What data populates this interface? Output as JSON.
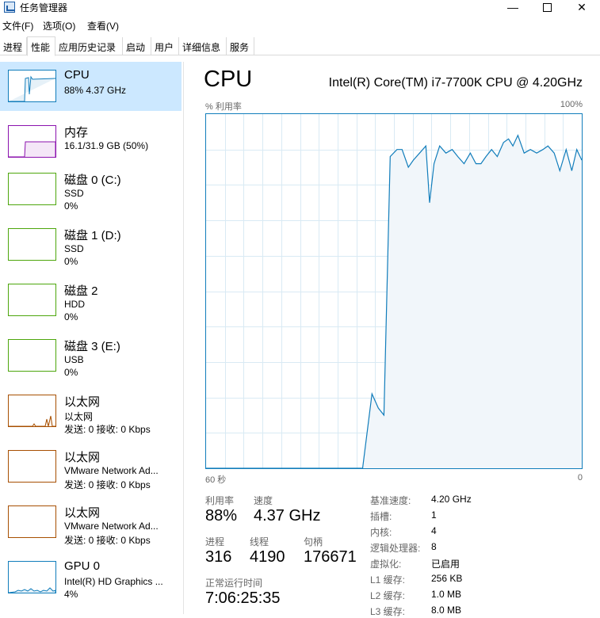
{
  "window": {
    "title": "任务管理器",
    "minimize": "—",
    "close": "✕"
  },
  "menu": [
    "文件(F)",
    "选项(O)",
    "查看(V)"
  ],
  "tabs": [
    "进程",
    "性能",
    "应用历史记录",
    "启动",
    "用户",
    "详细信息",
    "服务"
  ],
  "active_tab": "性能",
  "colors": {
    "cpu": "#117dbb",
    "memory": "#8b12ae",
    "disk": "#4da60c",
    "ethernet": "#a74f01",
    "selected": "#cce8ff"
  },
  "sidebar": [
    {
      "title": "CPU",
      "line2": "88% 4.37 GHz",
      "line3": ""
    },
    {
      "title": "内存",
      "line2": "16.1/31.9 GB (50%)",
      "line3": ""
    },
    {
      "title": "磁盘 0 (C:)",
      "line2": "SSD",
      "line3": "0%"
    },
    {
      "title": "磁盘 1 (D:)",
      "line2": "SSD",
      "line3": "0%"
    },
    {
      "title": "磁盘 2",
      "line2": "HDD",
      "line3": "0%"
    },
    {
      "title": "磁盘 3 (E:)",
      "line2": "USB",
      "line3": "0%"
    },
    {
      "title": "以太网",
      "line2": "以太网",
      "line3": "发送: 0 接收: 0 Kbps"
    },
    {
      "title": "以太网",
      "line2": "VMware Network Ad...",
      "line3": "发送: 0 接收: 0 Kbps"
    },
    {
      "title": "以太网",
      "line2": "VMware Network Ad...",
      "line3": "发送: 0 接收: 0 Kbps"
    },
    {
      "title": "GPU 0",
      "line2": "Intel(R) HD Graphics ...",
      "line3": "4%"
    }
  ],
  "main": {
    "title": "CPU",
    "model": "Intel(R) Core(TM) i7-7700K CPU @ 4.20GHz",
    "graph_label": "% 利用率",
    "graph_max": "100%",
    "graph_time_left": "60 秒",
    "graph_time_right": "0",
    "stats": {
      "utilization_label": "利用率",
      "utilization": "88%",
      "speed_label": "速度",
      "speed": "4.37 GHz",
      "processes_label": "进程",
      "processes": "316",
      "threads_label": "线程",
      "threads": "4190",
      "handles_label": "句柄",
      "handles": "176671",
      "uptime_label": "正常运行时间",
      "uptime": "7:06:25:35"
    },
    "specs": [
      {
        "label": "基准速度:",
        "value": "4.20 GHz"
      },
      {
        "label": "插槽:",
        "value": "1"
      },
      {
        "label": "内核:",
        "value": "4"
      },
      {
        "label": "逻辑处理器:",
        "value": "8"
      },
      {
        "label": "虚拟化:",
        "value": "已启用"
      },
      {
        "label": "L1 缓存:",
        "value": "256 KB"
      },
      {
        "label": "L2 缓存:",
        "value": "1.0 MB"
      },
      {
        "label": "L3 缓存:",
        "value": "8.0 MB"
      }
    ]
  },
  "chart_data": {
    "type": "area",
    "x": [
      60,
      57.5,
      55,
      52.5,
      50,
      47.5,
      45,
      42.5,
      40,
      37.5,
      35,
      33.5,
      32.5,
      31.6,
      30.6,
      29.5,
      28.7,
      27.7,
      26.9,
      25.9,
      24.9,
      24.3,
      23.6,
      22.7,
      21.7,
      20.7,
      19.8,
      18.8,
      17.8,
      16.9,
      16.1,
      15.3,
      14.4,
      13.5,
      12.5,
      11.7,
      11,
      10.2,
      9.2,
      8.2,
      7.2,
      6.2,
      5.4,
      4.4,
      3.5,
      2.5,
      1.6,
      0.8,
      0
    ],
    "values": [
      0,
      0,
      0,
      0,
      0,
      0,
      0,
      0,
      0,
      0,
      0,
      21,
      17,
      15,
      88,
      90,
      90,
      85,
      87,
      89,
      91,
      75,
      86,
      91,
      89,
      90,
      88,
      86,
      89,
      86,
      86,
      88,
      90,
      88,
      92,
      93,
      91,
      94,
      89,
      90,
      89,
      90,
      91,
      89,
      84,
      90,
      84,
      90,
      87
    ],
    "xlabel": "60 秒",
    "ylabel": "% 利用率",
    "ylim": [
      0,
      100
    ],
    "xlim": [
      60,
      0
    ],
    "grid": true
  }
}
